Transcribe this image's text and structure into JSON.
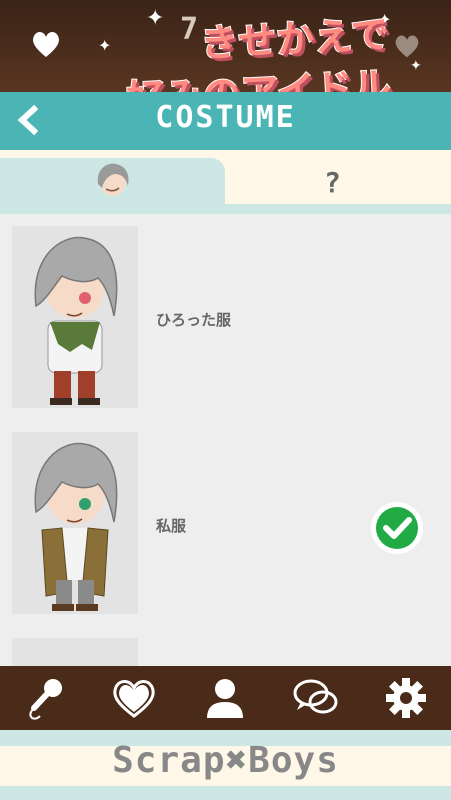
{
  "status": {
    "number": "7"
  },
  "promo": {
    "line1": "きせかえで",
    "line2": "好みのアイドルに！"
  },
  "header": {
    "title": "COSTUME"
  },
  "tabs": {
    "unknown_label": "?"
  },
  "costumes": [
    {
      "label": "ひろった服",
      "selected": false
    },
    {
      "label": "私服",
      "selected": true
    }
  ],
  "nav": {
    "items": [
      {
        "icon": "microphone-icon"
      },
      {
        "icon": "heart-icon"
      },
      {
        "icon": "user-icon"
      },
      {
        "icon": "chat-bubbles-icon"
      },
      {
        "icon": "gear-icon"
      }
    ]
  },
  "footer": {
    "logo": "Scrap✖Boys"
  },
  "colors": {
    "teal": "#4ab5b4",
    "brown": "#4a2b1a",
    "check": "#22aa44",
    "promo": "#ff8a80"
  }
}
